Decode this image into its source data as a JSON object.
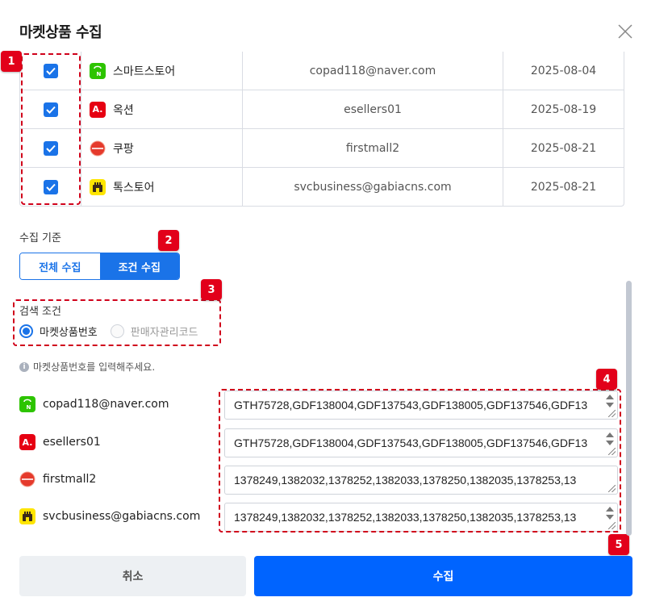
{
  "dialog": {
    "title": "마켓상품 수집"
  },
  "markets": [
    {
      "name": "스마트스토어",
      "account": "copad118@naver.com",
      "date": "2025-08-04",
      "icon": "smartstore-icon",
      "checked": true
    },
    {
      "name": "옥션",
      "account": "esellers01",
      "date": "2025-08-19",
      "icon": "auction-icon",
      "checked": true
    },
    {
      "name": "쿠팡",
      "account": "firstmall2",
      "date": "2025-08-21",
      "icon": "coupang-icon",
      "checked": true
    },
    {
      "name": "톡스토어",
      "account": "svcbusiness@gabiacns.com",
      "date": "2025-08-21",
      "icon": "talkstore-icon",
      "checked": true
    }
  ],
  "icon_glyphs": {
    "auction": "A."
  },
  "collect_basis": {
    "label": "수집 기준",
    "options": [
      "전체 수집",
      "조건 수집"
    ],
    "selected": "조건 수집"
  },
  "search_condition": {
    "label": "검색 조건",
    "options": [
      "마켓상품번호",
      "판매자관리코드"
    ],
    "selected": "마켓상품번호"
  },
  "hint": "마켓상품번호를 입력해주세요.",
  "codes": [
    {
      "account": "copad118@naver.com",
      "icon": "smartstore-icon",
      "value": "GTH75728,GDF138004,GDF137543,GDF138005,GDF137546,GDF13"
    },
    {
      "account": "esellers01",
      "icon": "auction-icon",
      "value": "GTH75728,GDF138004,GDF137543,GDF138005,GDF137546,GDF13"
    },
    {
      "account": "firstmall2",
      "icon": "coupang-icon",
      "value": "1378249,1382032,1378252,1382033,1378250,1382035,1378253,13"
    },
    {
      "account": "svcbusiness@gabiacns.com",
      "icon": "talkstore-icon",
      "value": "1378249,1382032,1378252,1382033,1378250,1382035,1378253,13"
    }
  ],
  "badges": [
    "1",
    "2",
    "3",
    "4",
    "5"
  ],
  "actions": {
    "cancel": "취소",
    "submit": "수집"
  },
  "colors": {
    "accent": "#1a73e8",
    "submit": "#0064ff",
    "annotation": "#d0021b"
  }
}
